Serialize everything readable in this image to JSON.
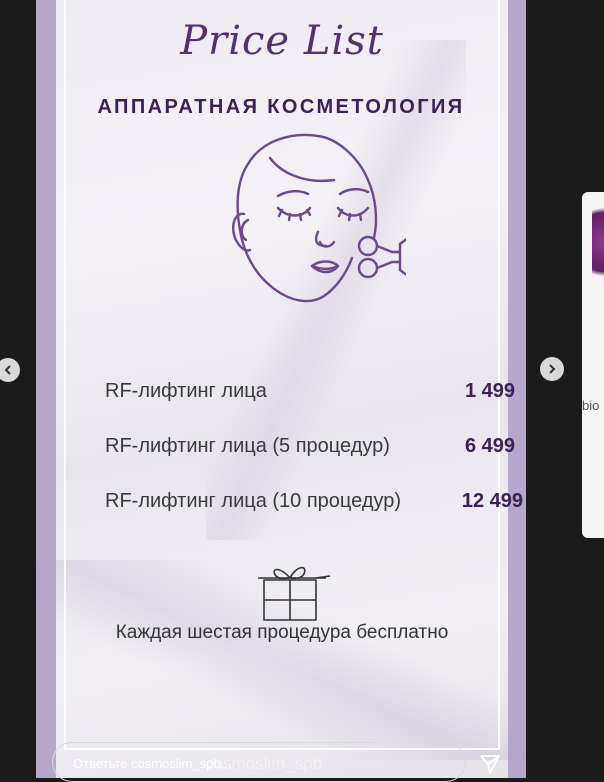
{
  "story": {
    "title": "Price List",
    "subtitle": "АППАРАТНАЯ КОСМЕТОЛОГИЯ",
    "items": [
      {
        "name": "RF-лифтинг лица",
        "price": "1 499"
      },
      {
        "name": "RF-лифтинг лица (5 процедур)",
        "price": "6 499"
      },
      {
        "name": "RF-лифтинг лица (10 процедур)",
        "price": "12 499"
      }
    ],
    "promo": "Каждая шестая процедура бесплатно",
    "watermark": "cosmoslim_spb"
  },
  "reply": {
    "placeholder": "Ответьте cosmoslim_spb..."
  },
  "next_preview": {
    "text": "bio"
  },
  "icons": {
    "prev": "chevron-left-icon",
    "next": "chevron-right-icon",
    "send": "send-icon",
    "face": "face-rf-device-icon",
    "gift": "gift-icon"
  },
  "colors": {
    "accent": "#54306e",
    "border": "#b6a8cc"
  }
}
